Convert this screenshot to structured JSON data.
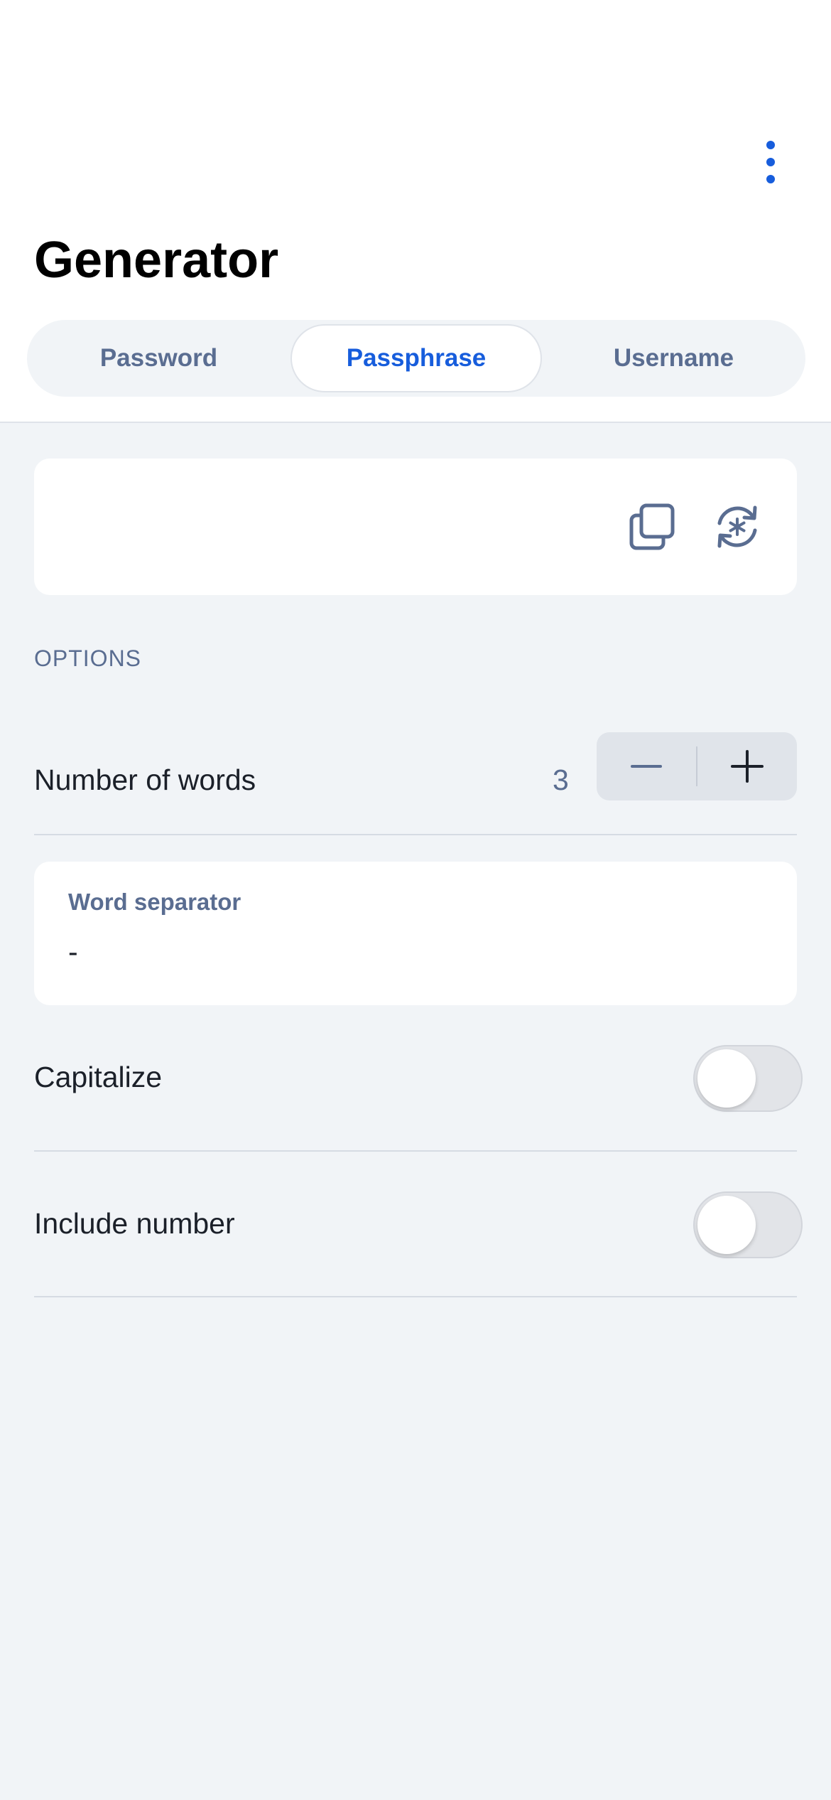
{
  "header": {
    "title": "Generator",
    "more_icon": "more-vertical-icon"
  },
  "tabs": [
    {
      "label": "Password",
      "selected": false
    },
    {
      "label": "Passphrase",
      "selected": true
    },
    {
      "label": "Username",
      "selected": false
    }
  ],
  "generated": {
    "value": "",
    "copy_icon": "copy-icon",
    "regenerate_icon": "regenerate-icon"
  },
  "options": {
    "section_label": "OPTIONS",
    "number_of_words": {
      "label": "Number of words",
      "value": "3"
    },
    "word_separator": {
      "label": "Word separator",
      "value": "-"
    },
    "capitalize": {
      "label": "Capitalize",
      "on": false
    },
    "include_number": {
      "label": "Include number",
      "on": false
    }
  },
  "colors": {
    "accent": "#175ddc",
    "muted": "#5a6d91",
    "background": "#f1f4f7"
  }
}
